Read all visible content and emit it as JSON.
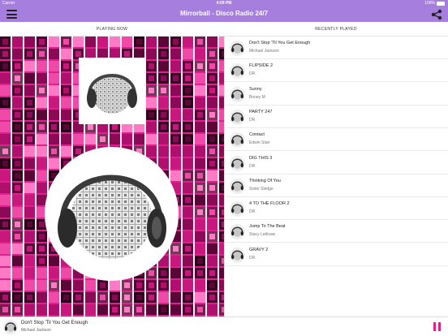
{
  "status_bar": {
    "carrier": "Carrier",
    "time": "4:09 PM",
    "battery": "100%"
  },
  "nav": {
    "title": "Mirrorball - Disco Radio 24/7",
    "menu_icon": "hamburger-menu-icon",
    "share_icon": "share-icon"
  },
  "tabs": [
    {
      "label": "PLAYING NOW"
    },
    {
      "label": "RECENTLY PLAYED"
    }
  ],
  "recently_played": [
    {
      "song": "Don't Stop 'Til You Get Enough",
      "artist": "Michael Jackson"
    },
    {
      "song": "FLIPSIDE 2",
      "artist": "DR"
    },
    {
      "song": "Sunny",
      "artist": "Boney M"
    },
    {
      "song": "PARTY 247",
      "artist": "DR"
    },
    {
      "song": "Contact",
      "artist": "Edwin Starr"
    },
    {
      "song": "DIG THIS 3",
      "artist": "DR"
    },
    {
      "song": "Thinking Of You",
      "artist": "Sister Sledge"
    },
    {
      "song": "4 TO THE FLOOR 2",
      "artist": "DR"
    },
    {
      "song": "Jump To The Beat",
      "artist": "Stacy Lattisaw"
    },
    {
      "song": "GRAVY 2",
      "artist": "DR"
    }
  ],
  "now_playing": {
    "song": "Don't Stop 'Til You Get Enough",
    "artist": "Michael Jackson",
    "pause_icon": "pause-icon"
  },
  "colors": {
    "accent": "#a67fde",
    "background_pink": "#e0208f",
    "pause": "#e0208f"
  }
}
